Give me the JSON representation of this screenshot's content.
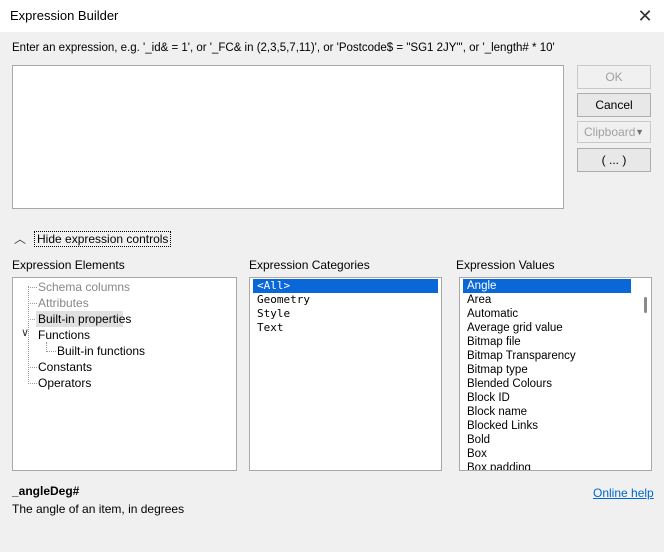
{
  "window": {
    "title": "Expression Builder",
    "close_glyph": "✕"
  },
  "hint": "Enter an expression, e.g. '_id& = 1', or '_FC& in (2,3,5,7,11)', or 'Postcode$ = \"SG1 2JY\"', or '_length# * 10'",
  "buttons": {
    "ok": "OK",
    "cancel": "Cancel",
    "clipboard": "Clipboard",
    "more": "( ... )"
  },
  "toggle": {
    "label": "Hide expression controls"
  },
  "elements": {
    "label": "Expression Elements",
    "items": [
      {
        "label": "Schema columns",
        "state": "disabled"
      },
      {
        "label": "Attributes",
        "state": "disabled"
      },
      {
        "label": "Built-in properties",
        "state": "selected"
      },
      {
        "label": "Functions",
        "state": "expanded"
      },
      {
        "label": "Built-in functions",
        "state": "child"
      },
      {
        "label": "Constants",
        "state": "normal"
      },
      {
        "label": "Operators",
        "state": "normal"
      }
    ]
  },
  "categories": {
    "label": "Expression Categories",
    "items": [
      "<All>",
      "Geometry",
      "Style",
      "Text"
    ],
    "selected": "<All>"
  },
  "values": {
    "label": "Expression Values",
    "items": [
      "Angle",
      "Area",
      "Automatic",
      "Average grid value",
      "Bitmap file",
      "Bitmap Transparency",
      "Bitmap type",
      "Blended Colours",
      "Block ID",
      "Block name",
      "Blocked Links",
      "Bold",
      "Box",
      "Box padding"
    ],
    "selected": "Angle"
  },
  "detail": {
    "name": "_angleDeg#",
    "description": "The angle of an item, in degrees"
  },
  "help_link": "Online help",
  "colors": {
    "selection": "#0a67d8",
    "link": "#0066cc"
  }
}
